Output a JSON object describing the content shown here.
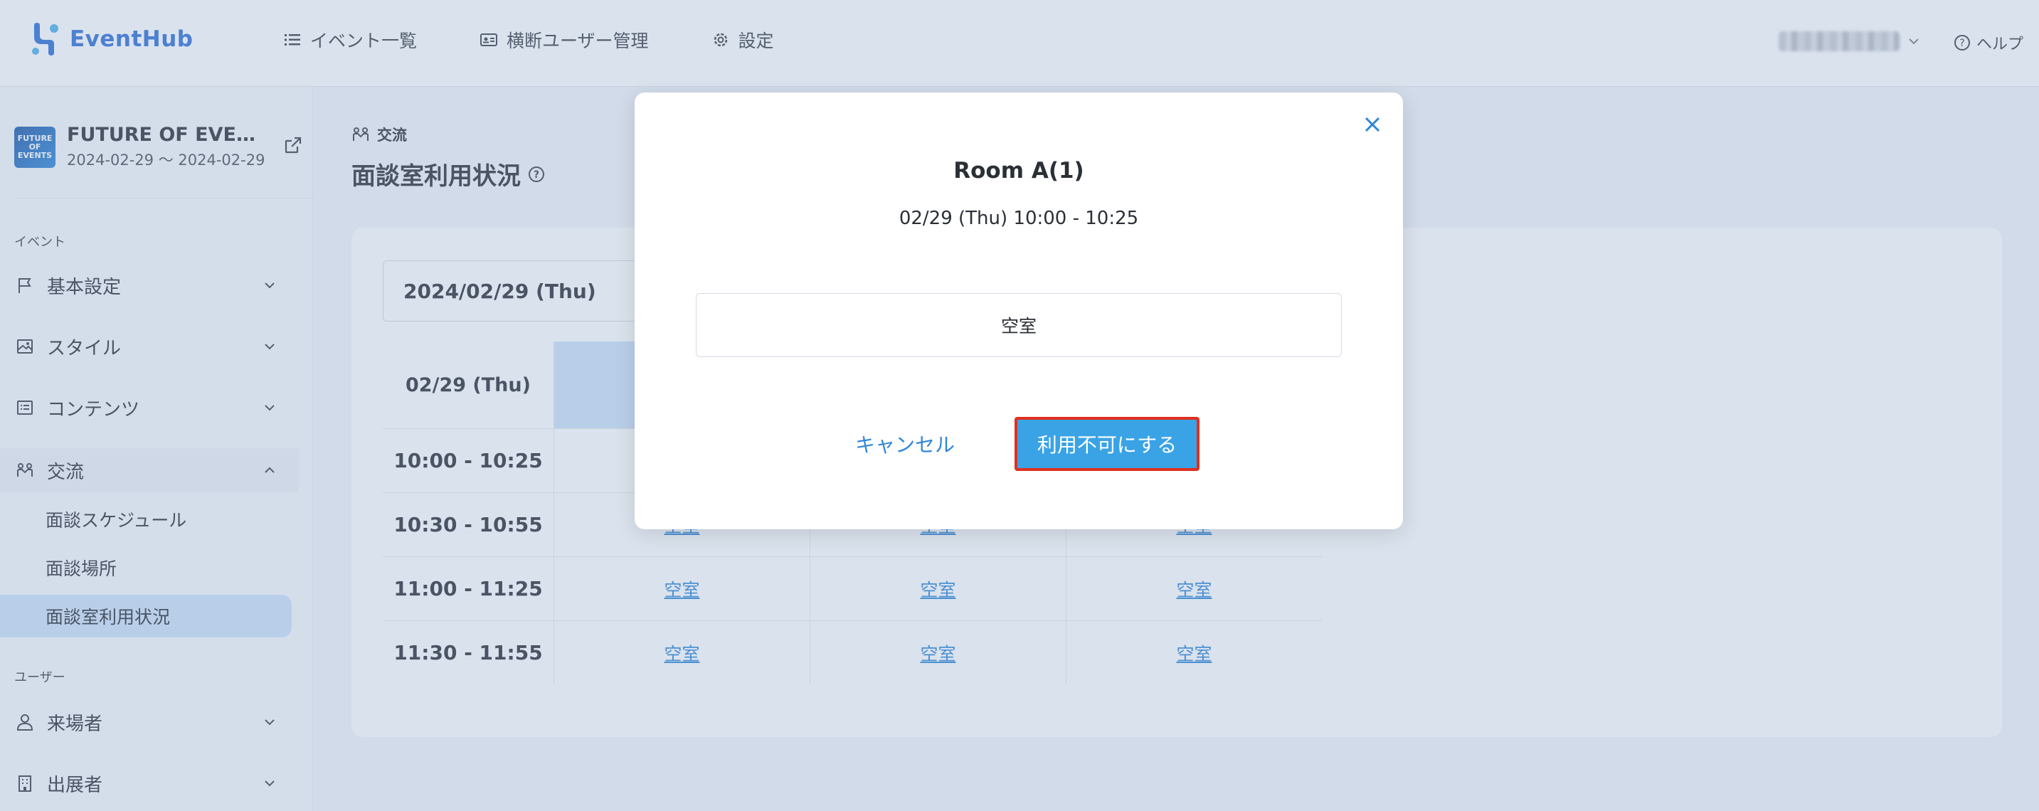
{
  "header": {
    "brand": "EventHub",
    "nav": [
      {
        "label": "イベント一覧",
        "icon": "list-icon"
      },
      {
        "label": "横断ユーザー管理",
        "icon": "id-card-icon"
      },
      {
        "label": "設定",
        "icon": "gear-icon"
      }
    ],
    "help": "ヘルプ"
  },
  "sidebar": {
    "event": {
      "thumb": "FUTURE OF EVENTS",
      "title": "FUTURE OF EVEN...",
      "dates": "2024-02-29 〜 2024-02-29"
    },
    "section_event": "イベント",
    "items": [
      {
        "label": "基本設定",
        "icon": "flag-icon"
      },
      {
        "label": "スタイル",
        "icon": "image-icon"
      },
      {
        "label": "コンテンツ",
        "icon": "list-box-icon"
      },
      {
        "label": "交流",
        "icon": "interaction-icon"
      }
    ],
    "sub_items": [
      {
        "label": "面談スケジュール"
      },
      {
        "label": "面談場所"
      },
      {
        "label": "面談室利用状況"
      }
    ],
    "section_user": "ユーザー",
    "user_items": [
      {
        "label": "来場者",
        "icon": "person-icon"
      },
      {
        "label": "出展者",
        "icon": "building-icon"
      }
    ]
  },
  "main": {
    "breadcrumb": "交流",
    "title": "面談室利用状況",
    "date_select": "2024/02/29 (Thu)",
    "table": {
      "date_header": "02/29 (Thu)",
      "times": [
        "10:00 - 10:25",
        "10:30 - 10:55",
        "11:00 - 11:25",
        "11:30 - 11:55"
      ],
      "vacant_label": "空室"
    }
  },
  "modal": {
    "title": "Room A(1)",
    "subtitle": "02/29 (Thu) 10:00 - 10:25",
    "status": "空室",
    "cancel_label": "キャンセル",
    "confirm_label": "利用不可にする"
  },
  "colors": {
    "brand": "#2e6fd6",
    "link": "#2f86d8",
    "confirm_button": "#3aa3e6",
    "highlight_border": "#e0301e",
    "active_nav": "#cfe3fa"
  }
}
